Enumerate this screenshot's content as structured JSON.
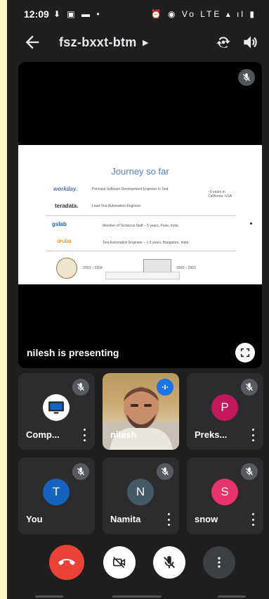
{
  "status_bar": {
    "time": "12:09",
    "left_icons": "⬇ ▣ ▬ •",
    "right_icons": "⏰ ◉ Vo LTE ▴ ıl ▮"
  },
  "header": {
    "meeting_code": "fsz-bxxt-btm"
  },
  "presentation": {
    "presenting_label": "nilesh is presenting",
    "slide": {
      "title": "Journey so far",
      "rows": [
        {
          "logo": "workday.",
          "text": "Principal Software Development Engineer in Test"
        },
        {
          "logo": "teradata.",
          "text": "Lead Test Automation Engineer"
        },
        {
          "logo": "gslab",
          "text": "Member of Technical Staff – 5 years, Pune, India"
        },
        {
          "logo": "aruba",
          "text": "Test Automation Engineer – 1.5 years, Bangalore, India"
        }
      ],
      "side_note": "~9 years in California, USA",
      "years_left": "2003 – 2004",
      "years_right": "2000 – 2003"
    }
  },
  "participants": [
    {
      "name": "Comp...",
      "type": "icon",
      "muted": true
    },
    {
      "name": "nilesh",
      "type": "video",
      "speaking": true
    },
    {
      "name": "Preks...",
      "initial": "P",
      "color": "#c2185b",
      "muted": true
    },
    {
      "name": "You",
      "initial": "T",
      "color": "#1565c0",
      "muted": true
    },
    {
      "name": "Namita",
      "initial": "N",
      "color": "#455a64",
      "muted": true
    },
    {
      "name": "snow",
      "initial": "S",
      "color": "#e8336d",
      "muted": true
    }
  ],
  "colors": {
    "end_call": "#ea4335",
    "control_light": "#ffffff",
    "control_dark": "#3c4043"
  }
}
